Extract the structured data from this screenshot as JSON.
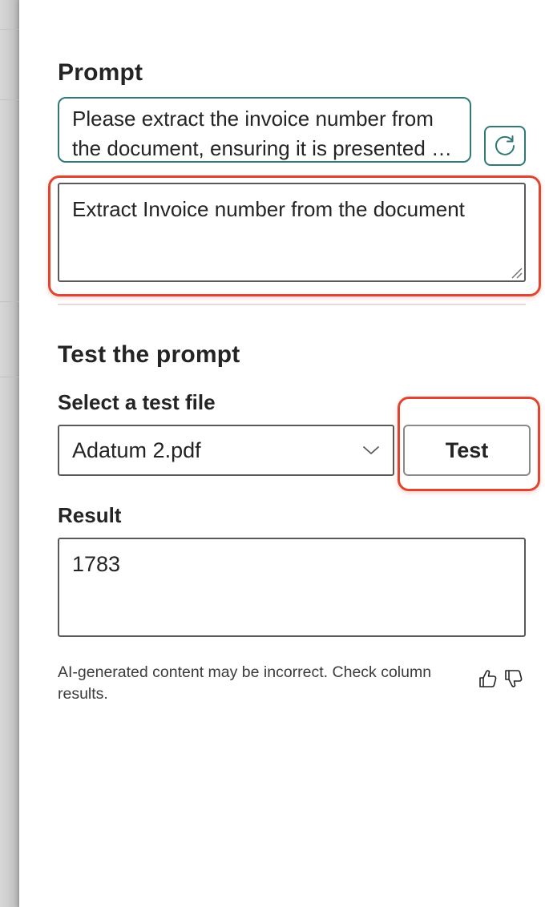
{
  "prompt_section": {
    "title": "Prompt",
    "suggestion_line1": "Please extract the invoice number from",
    "suggestion_line2": "the document, ensuring it is presented clearly",
    "refresh_icon": "refresh-icon",
    "input_value": "Extract Invoice number from the document"
  },
  "test_section": {
    "title": "Test the prompt",
    "file_label": "Select a test file",
    "selected_file": "Adatum 2.pdf",
    "test_button": "Test",
    "result_label": "Result",
    "result_value": "1783",
    "disclaimer": "AI-generated content may be incorrect. Check column results.",
    "like_icon": "thumbs-up-icon",
    "dislike_icon": "thumbs-down-icon"
  },
  "colors": {
    "accent_teal": "#2f7a74",
    "highlight_red": "#e0452f",
    "border_gray": "#5a5a5a",
    "text": "#242424"
  }
}
